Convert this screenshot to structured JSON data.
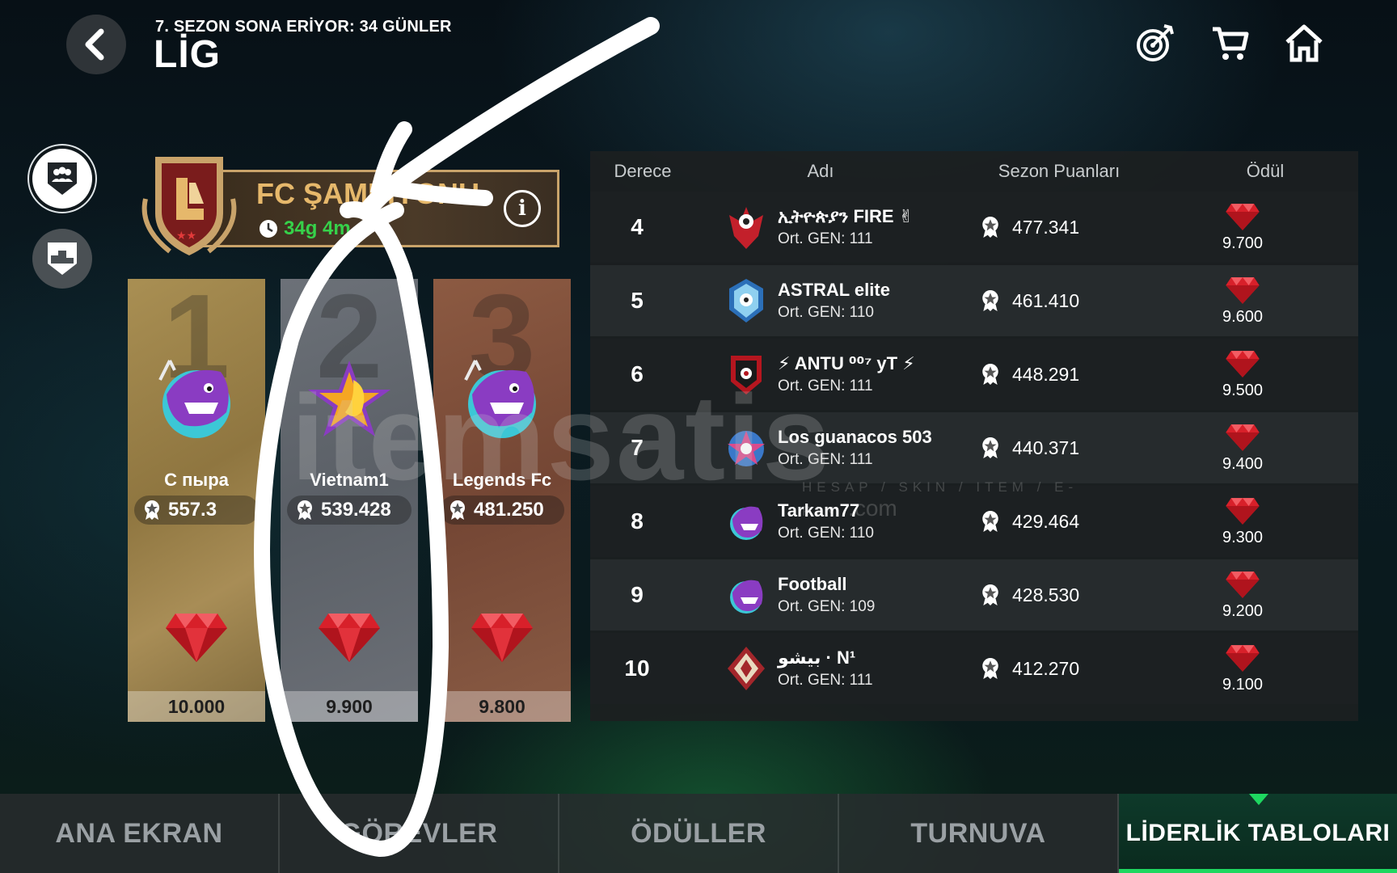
{
  "header": {
    "season_text": "7. SEZON SONA ERİYOR: 34 GÜNLER",
    "title": "LİG",
    "top_icons": [
      "target-icon",
      "cart-icon",
      "home-icon"
    ]
  },
  "side": {
    "icons": [
      "team-icon",
      "podium-icon"
    ]
  },
  "league": {
    "name": "FC ŞAMPİYONU",
    "timer": "34g 4m"
  },
  "podium": [
    {
      "rank": "1",
      "name": "С пыра",
      "points": "557.3",
      "reward": "10.000"
    },
    {
      "rank": "2",
      "name": "Vietnam1",
      "points": "539.428",
      "reward": "9.900"
    },
    {
      "rank": "3",
      "name": "Legends Fc",
      "points": "481.250",
      "reward": "9.800"
    }
  ],
  "table": {
    "headers": {
      "rank": "Derece",
      "name": "Adı",
      "points": "Sezon Puanları",
      "reward": "Ödül"
    },
    "rows": [
      {
        "rank": "4",
        "name": "ኢትዮጵያን FIRE ✌",
        "gen": "Ort. GEN: 111",
        "points": "477.341",
        "reward": "9.700"
      },
      {
        "rank": "5",
        "name": "ASTRAL elite",
        "gen": "Ort. GEN: 110",
        "points": "461.410",
        "reward": "9.600"
      },
      {
        "rank": "6",
        "name": "⚡ ANTU ⁰⁰⁷ yT ⚡",
        "gen": "Ort. GEN: 111",
        "points": "448.291",
        "reward": "9.500"
      },
      {
        "rank": "7",
        "name": "Los guanacos 503",
        "gen": "Ort. GEN: 111",
        "points": "440.371",
        "reward": "9.400"
      },
      {
        "rank": "8",
        "name": "Tarkam77",
        "gen": "Ort. GEN: 110",
        "points": "429.464",
        "reward": "9.300"
      },
      {
        "rank": "9",
        "name": "Football",
        "gen": "Ort. GEN: 109",
        "points": "428.530",
        "reward": "9.200"
      },
      {
        "rank": "10",
        "name": "بيشو · N¹",
        "gen": "Ort. GEN: 111",
        "points": "412.270",
        "reward": "9.100"
      }
    ]
  },
  "nav": [
    "ANA EKRAN",
    "GÖREVLER",
    "ÖDÜLLER",
    "TURNUVA",
    "LİDERLİK TABLOLARI"
  ],
  "watermark": {
    "main": "itemsatis",
    "sub": "HESAP / SKIN / ITEM / E-PIN",
    "com": ".com"
  },
  "colors": {
    "accent": "#1ed760",
    "gold_text": "#e6b86b",
    "timer_green": "#36d14a",
    "gem_red": "#d8202a"
  }
}
